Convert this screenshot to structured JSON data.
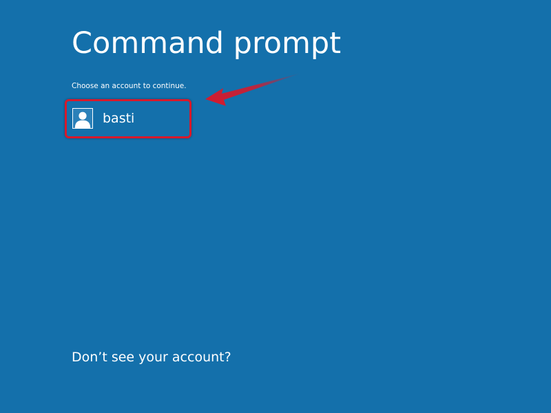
{
  "header": {
    "title": "Command prompt",
    "subtitle": "Choose an account to continue."
  },
  "accounts": [
    {
      "name": "basti",
      "icon": "user-icon"
    }
  ],
  "footer": {
    "help_link": "Don’t see your account?"
  },
  "colors": {
    "background": "#1470ab",
    "highlight": "#d7192b",
    "text": "#ffffff"
  }
}
